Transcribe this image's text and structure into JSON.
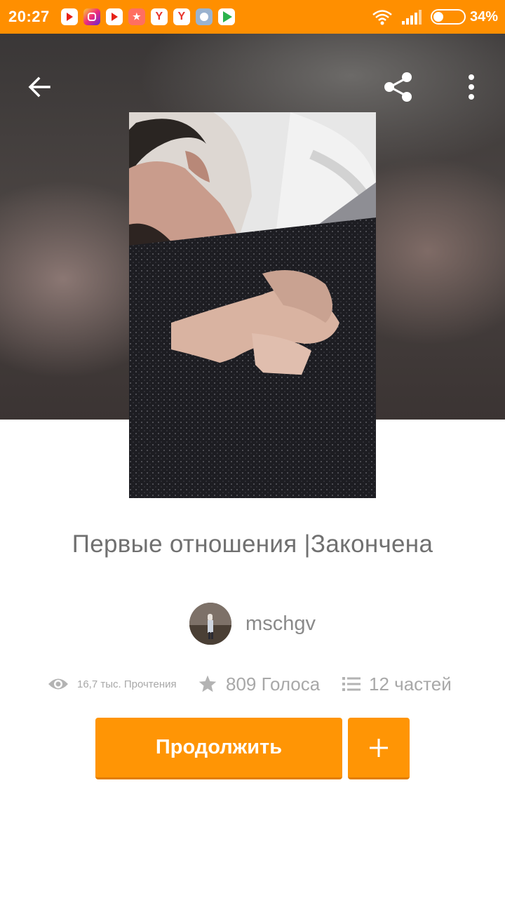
{
  "status_bar": {
    "time": "20:27",
    "battery_percent_label": "34%",
    "battery_level": 0.34,
    "notification_icons": [
      "youtube-icon",
      "instagram-icon",
      "youtube-icon",
      "gift-icon",
      "yandex-icon",
      "yandex-icon",
      "app-icon",
      "play-store-icon"
    ],
    "yandex_letter": "Y"
  },
  "toolbar": {
    "back_icon": "arrow-left-icon",
    "share_icon": "share-icon",
    "more_icon": "more-vertical-icon"
  },
  "story": {
    "title": "Первые отношения |Закончена",
    "author": "mschgv",
    "reads": "16,7 тыс. Прочтения",
    "votes": "809 Голоса",
    "parts": "12 частей"
  },
  "actions": {
    "continue_label": "Продолжить",
    "add_icon": "plus-icon"
  },
  "colors": {
    "accent": "#ff8f00",
    "button": "#ff9505",
    "title_text": "#707070",
    "stats_text": "#a8a8a8"
  }
}
